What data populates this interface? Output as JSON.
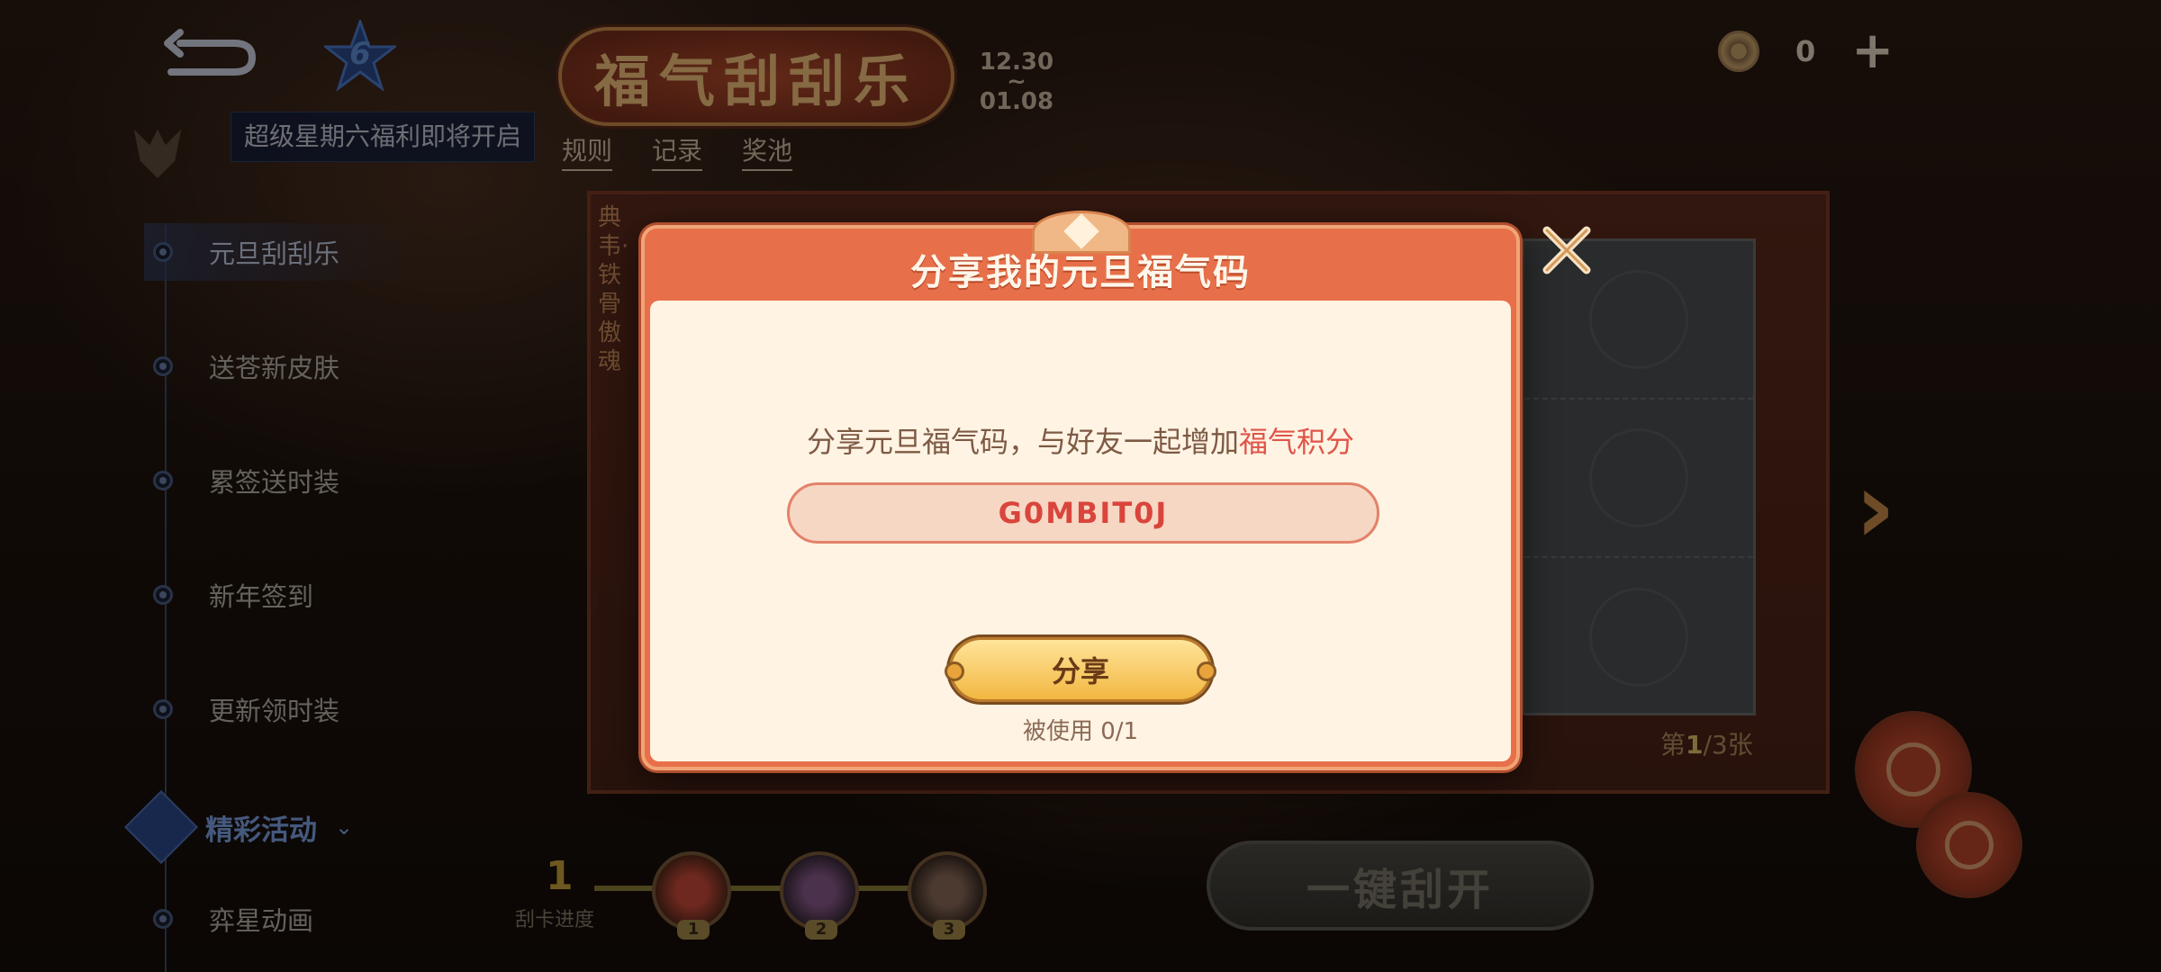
{
  "header": {
    "level": "6",
    "notice": "超级星期六福利即将开启",
    "event_title": "福气刮刮乐",
    "date_start": "12.30",
    "date_sep": "~",
    "date_end": "01.08",
    "links": [
      "规则",
      "记录",
      "奖池"
    ],
    "coin_count": "0"
  },
  "sidebar": {
    "items": [
      {
        "label": "元旦刮刮乐",
        "active": true
      },
      {
        "label": "送苍新皮肤"
      },
      {
        "label": "累签送时装"
      },
      {
        "label": "新年签到"
      },
      {
        "label": "更新领时装"
      }
    ],
    "section_label": "精彩活动",
    "section_items": [
      {
        "label": "弈星动画"
      }
    ]
  },
  "board": {
    "side_text": "典韦·铁骨傲魂",
    "page_prefix": "第",
    "page_current": "1",
    "page_total": "/3张"
  },
  "progress": {
    "value": "1",
    "label": "刮卡进度",
    "nodes": [
      "1",
      "2",
      "3"
    ]
  },
  "one_key_label": "一键刮开",
  "modal": {
    "title": "分享我的元旦福气码",
    "desc_prefix": "分享元旦福气码，与好友一起增加",
    "desc_highlight": "福气积分",
    "code": "G0MBIT0J",
    "share_label": "分享",
    "used_text": "被使用 0/1"
  },
  "colors": {
    "accent": "#e7704a",
    "code_text": "#d9453c",
    "highlight": "#e0544a",
    "sidebar_section": "#7fa2e6"
  }
}
